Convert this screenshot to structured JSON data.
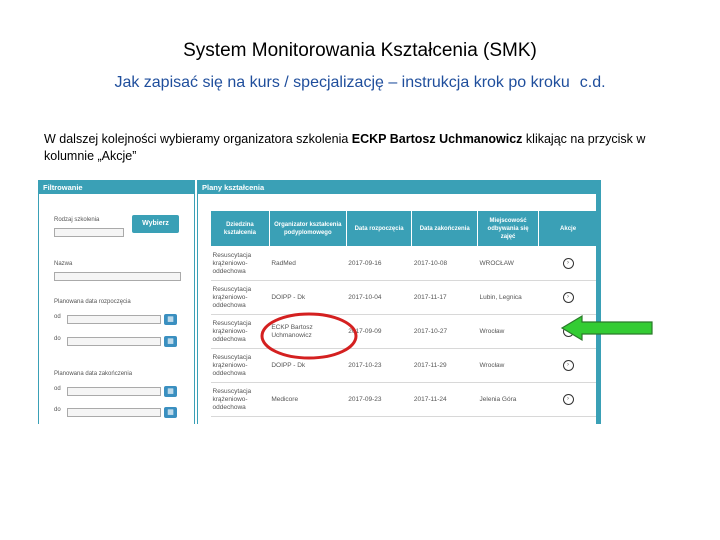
{
  "slide": {
    "title": "System Monitorowania Kształcenia (SMK)",
    "subtitle": "Jak zapisać się na kurs / specjalizację – instrukcja krok po kroku",
    "subtitle_suffix": "c.d.",
    "instruction_pre": "W dalszej kolejności wybieramy organizatora szkolenia ",
    "instruction_bold": "ECKP Bartosz Uchmanowicz",
    "instruction_post": " klikając na przycisk w kolumnie „Akcje”"
  },
  "filter_panel": {
    "header": "Filtrowanie",
    "field1_label": "Rodzaj szkolenia",
    "field2_label": "Nazwa",
    "start_date_label": "Planowana data rozpoczęcia",
    "end_date_label": "Planowana data zakończenia",
    "from_label": "od",
    "to_label": "do",
    "search_button": "Wybierz"
  },
  "plans_panel": {
    "header": "Plany kształcenia",
    "columns": [
      "Dziedzina kształcenia",
      "Organizator kształcenia podyplomowego",
      "Data rozpoczęcia",
      "Data zakończenia",
      "Miejscowość odbywania się zajęć",
      "Akcje"
    ],
    "rows": [
      {
        "field": "Resuscytacja krążeniowo-oddechowa",
        "organizer": "RadMed",
        "start": "2017-09-16",
        "end": "2017-10-08",
        "place": "WROCŁAW"
      },
      {
        "field": "Resuscytacja krążeniowo-oddechowa",
        "organizer": "DOIPP - Dk",
        "start": "2017-10-04",
        "end": "2017-11-17",
        "place": "Lubin, Legnica"
      },
      {
        "field": "Resuscytacja krążeniowo-oddechowa",
        "organizer": "ECKP Bartosz Uchmanowicz",
        "start": "2017-09-09",
        "end": "2017-10-27",
        "place": "Wrocław"
      },
      {
        "field": "Resuscytacja krążeniowo-oddechowa",
        "organizer": "DOIPP - Dk",
        "start": "2017-10-23",
        "end": "2017-11-29",
        "place": "Wrocław"
      },
      {
        "field": "Resuscytacja krążeniowo-oddechowa",
        "organizer": "Medicore",
        "start": "2017-09-23",
        "end": "2017-11-24",
        "place": "Jelenia Góra"
      }
    ]
  },
  "colors": {
    "accent": "#3aa0b6",
    "subtitle": "#1f4e9c",
    "highlight_circle": "#d42020",
    "arrow_fill": "#33cc33"
  }
}
